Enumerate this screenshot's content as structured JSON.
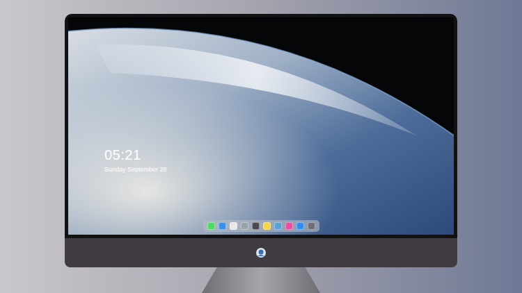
{
  "desktop": {
    "time": "05:21",
    "date": "Sunday September 28"
  },
  "dock": {
    "items": [
      {
        "color": "#4cd964"
      },
      {
        "color": "#3b8fe8"
      },
      {
        "color": "#e8e8e8"
      },
      {
        "color": "#9aa3ad"
      },
      {
        "color": "#4a4a52"
      },
      {
        "color": "#f5d547"
      },
      {
        "color": "#5aa0d8"
      },
      {
        "color": "#e84fa0"
      },
      {
        "color": "#2f8cf0"
      },
      {
        "color": "#6d6f75"
      }
    ]
  }
}
